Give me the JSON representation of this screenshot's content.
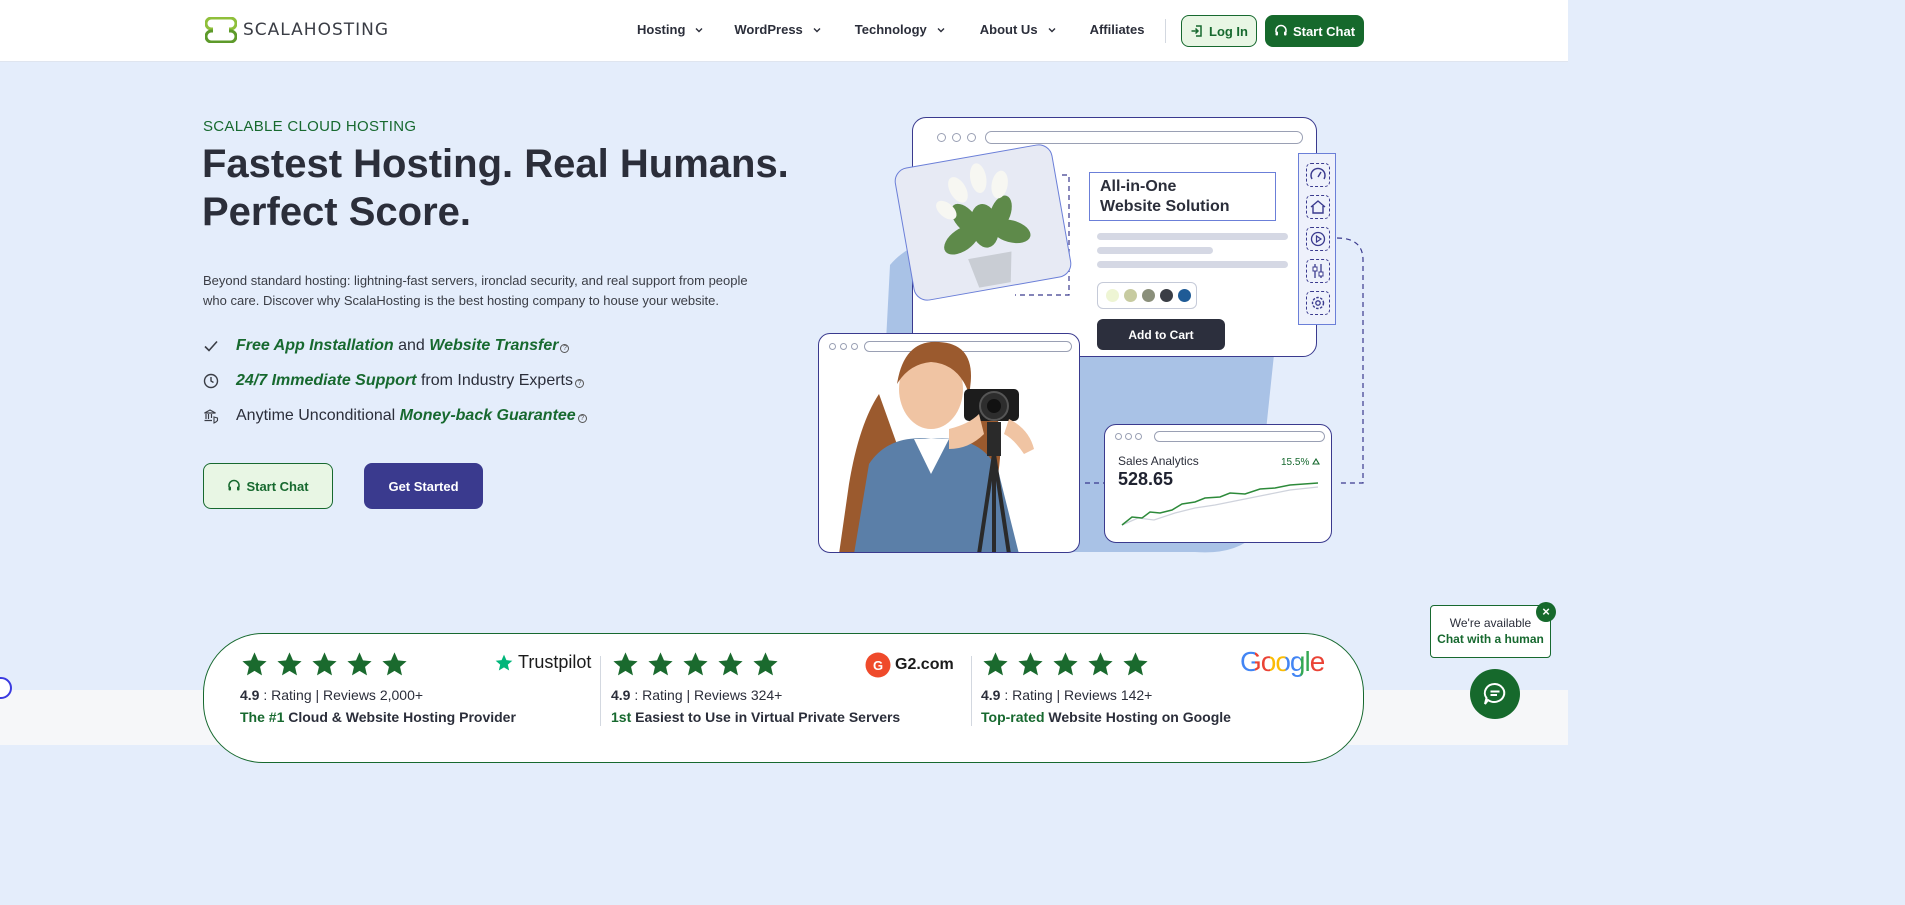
{
  "header": {
    "logo_text": "SCALAHOSTING",
    "nav": [
      {
        "label": "Hosting",
        "has_dropdown": true
      },
      {
        "label": "WordPress",
        "has_dropdown": true
      },
      {
        "label": "Technology",
        "has_dropdown": true
      },
      {
        "label": "About Us",
        "has_dropdown": true
      },
      {
        "label": "Affiliates",
        "has_dropdown": false
      }
    ],
    "login_label": "Log In",
    "start_chat_label": "Start Chat"
  },
  "hero": {
    "eyebrow": "SCALABLE CLOUD HOSTING",
    "title_line1": "Fastest Hosting. Real Humans.",
    "title_line2": "Perfect Score.",
    "description": "Beyond standard hosting: lightning-fast servers, ironclad security, and real support from people who care. Discover why ScalaHosting is the best hosting company to house your website.",
    "features": [
      {
        "icon": "check-icon",
        "em1": "Free App Installation",
        "mid": " and ",
        "em2": "Website Transfer",
        "tail": ""
      },
      {
        "icon": "clock-icon",
        "em1": "24/7 Immediate Support",
        "mid": " from Industry Experts",
        "em2": "",
        "tail": ""
      },
      {
        "icon": "bank-shield-icon",
        "pre": "Anytime Unconditional ",
        "em1": "Money-back Guarantee",
        "mid": "",
        "em2": "",
        "tail": ""
      }
    ],
    "start_chat_label": "Start Chat",
    "get_started_label": "Get Started"
  },
  "illustration": {
    "aio_line1": "All-in-One",
    "aio_line2": "Website Solution",
    "add_to_cart": "Add to Cart",
    "swatch_colors": [
      "#eef5d4",
      "#c7cba0",
      "#8a8f7a",
      "#3a3d45",
      "#1f5b96"
    ],
    "analytics_label": "Sales Analytics",
    "analytics_value": "528.65",
    "analytics_change": "15.5%",
    "tool_icons": [
      "speedometer-icon",
      "home-icon",
      "play-icon",
      "sliders-icon",
      "settings-icon"
    ]
  },
  "ratings": [
    {
      "brand": "Trustpilot",
      "stars": 5,
      "score": "4.9",
      "meta": " : Rating | Reviews 2,000+",
      "tag_em": "The #1",
      "tag_rest": " Cloud & Website Hosting Provider"
    },
    {
      "brand": "G2.com",
      "stars": 5,
      "score": "4.9",
      "meta": " : Rating | Reviews 324+",
      "tag_em": "1st",
      "tag_rest": " Easiest to Use in Virtual Private Servers"
    },
    {
      "brand": "Google",
      "stars": 5,
      "score": "4.9",
      "meta": " : Rating | Reviews 142+",
      "tag_em": "Top-rated",
      "tag_rest": " Website Hosting on Google"
    }
  ],
  "chat_widget": {
    "line1": "We're available",
    "line2": "Chat with a human"
  },
  "colors": {
    "brand_green": "#16692c",
    "accent_purple": "#3a3a8e",
    "hero_bg": "#e4edfb"
  }
}
